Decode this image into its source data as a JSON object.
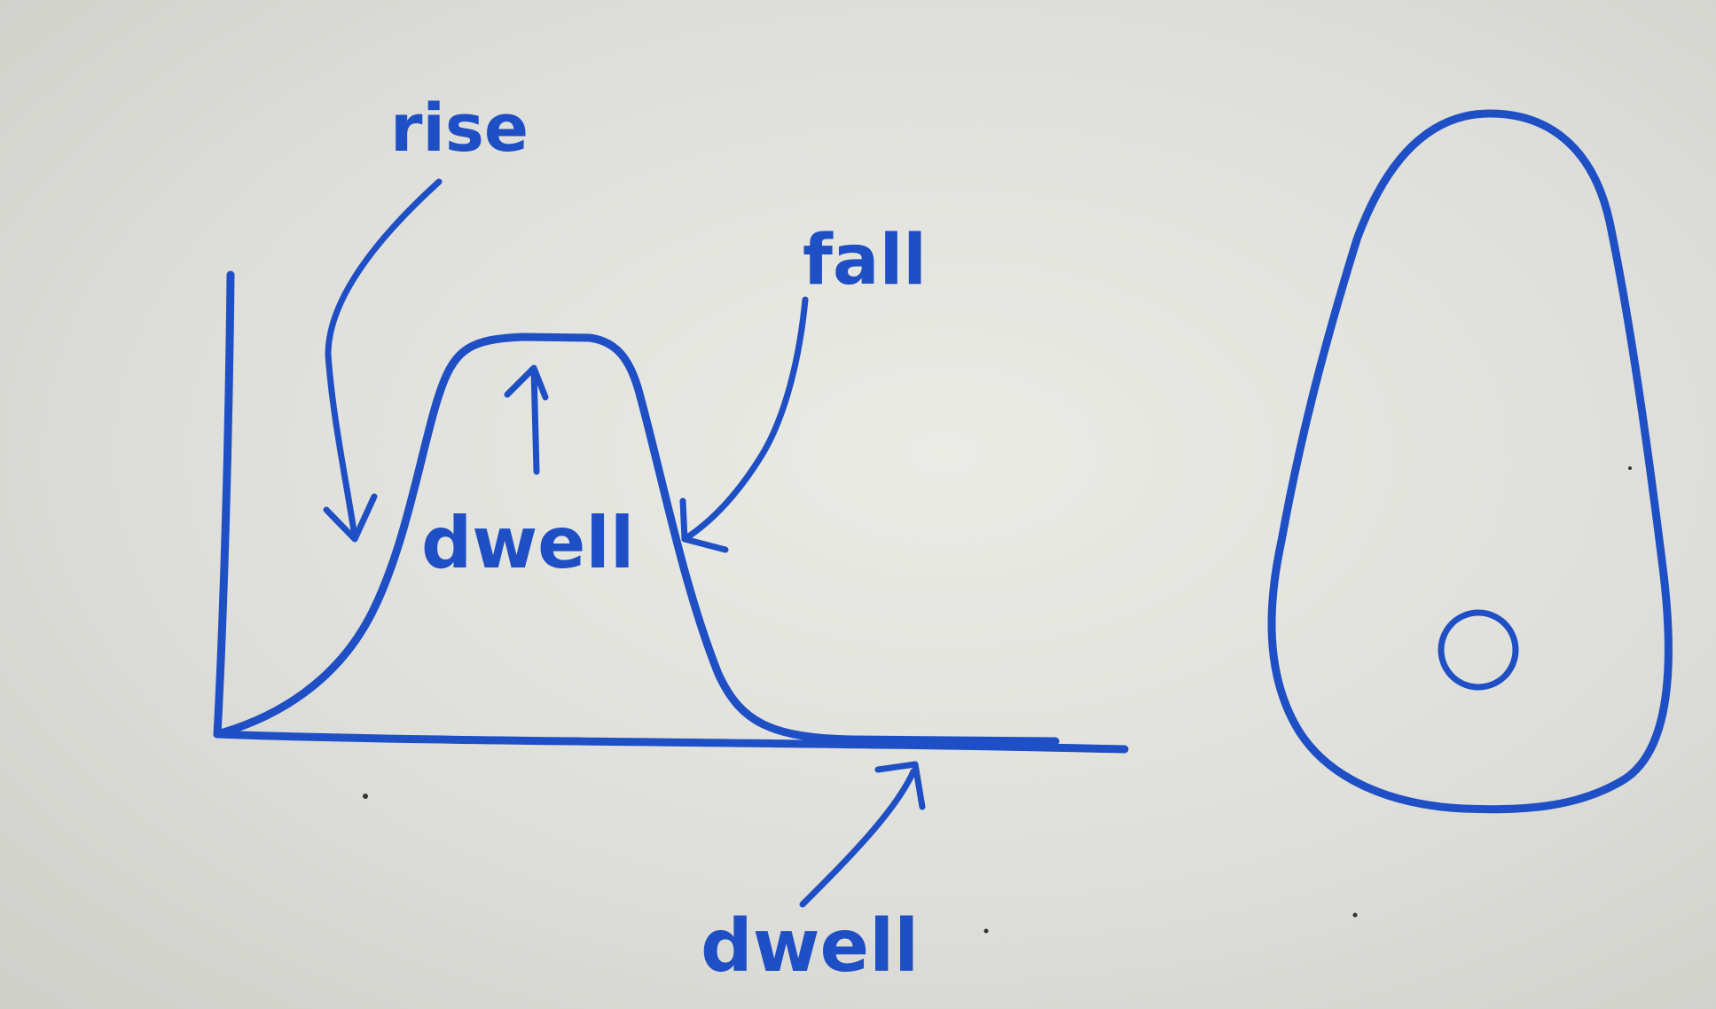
{
  "labels": {
    "rise": "rise",
    "fall": "fall",
    "dwell_top": "dwell",
    "dwell_bottom": "dwell"
  },
  "colors": {
    "ink": "#1f4fc4",
    "board": "#e2e2dd"
  }
}
